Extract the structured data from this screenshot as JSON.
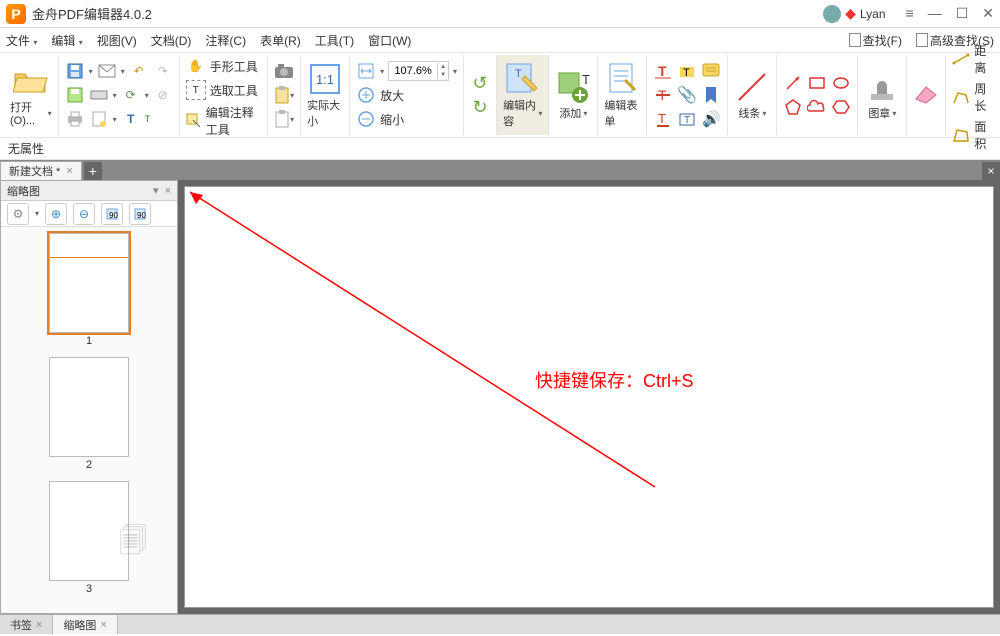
{
  "app": {
    "title": "金舟PDF编辑器4.0.2"
  },
  "user": {
    "name": "Lyan"
  },
  "menus": {
    "file": "文件",
    "edit": "编辑",
    "view": "视图(V)",
    "doc": "文档(D)",
    "annot": "注释(C)",
    "form": "表单(R)",
    "tools": "工具(T)",
    "window": "窗口(W)",
    "find": "查找(F)",
    "advfind": "高级查找(S)"
  },
  "toolbar": {
    "open": "打开(O)...",
    "hand": "手形工具",
    "select": "选取工具",
    "edit_annot_tool": "编辑注释工具",
    "actual_size": "实际大小",
    "zoom_value": "107.6%",
    "zoom_in": "放大",
    "zoom_out": "缩小",
    "edit_content": "编辑内容",
    "add": "添加",
    "edit_form": "编辑表单",
    "lines": "线条",
    "stamp": "图章",
    "distance": "距离",
    "perimeter": "周长",
    "area": "面积"
  },
  "props": {
    "label": "无属性"
  },
  "tabs": {
    "doc1": "新建文档 *"
  },
  "thumbs": {
    "title": "缩略图",
    "pages": [
      "1",
      "2",
      "3"
    ]
  },
  "panel_tabs": {
    "bookmark": "书签",
    "thumb": "缩略图"
  },
  "annotation": {
    "text": "快捷键保存：Ctrl+S"
  }
}
